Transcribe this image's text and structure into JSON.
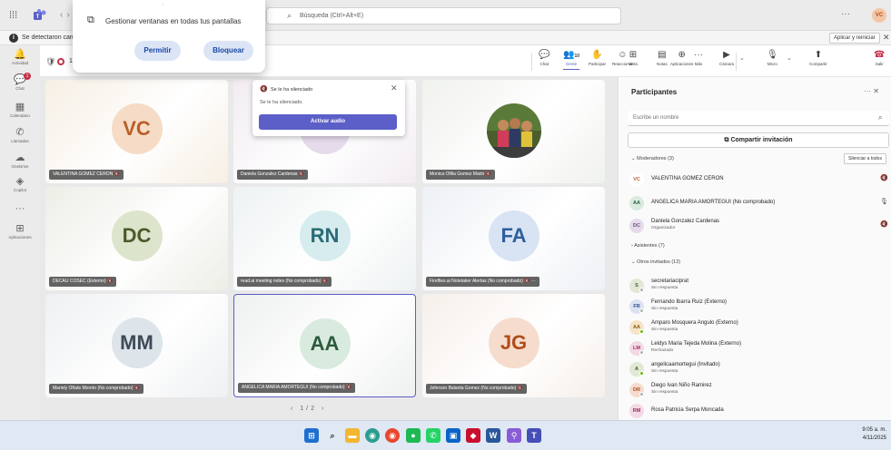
{
  "titlebar": {
    "search_placeholder": "Búsqueda (Ctrl+Alt+E)",
    "more": "···",
    "me_initials": "VC"
  },
  "notification": {
    "text": "Se detectaron cam",
    "apply_label": "Aplicar y reiniciar",
    "close": "✕"
  },
  "permission_popup": {
    "text": "Gestionar ventanas en todas tus pantallas",
    "allow": "Permitir",
    "block": "Bloquear"
  },
  "rail": [
    {
      "icon": "bell-icon",
      "glyph": "🔔",
      "label": "Actividad"
    },
    {
      "icon": "chat-icon",
      "glyph": "💬",
      "label": "Chat",
      "badge": "1"
    },
    {
      "icon": "calendar-icon",
      "glyph": "▦",
      "label": "Calendario"
    },
    {
      "icon": "phone-icon",
      "glyph": "✆",
      "label": "Llamadas"
    },
    {
      "icon": "cloud-icon",
      "glyph": "☁",
      "label": "OneDrive"
    },
    {
      "icon": "copilot-icon",
      "glyph": "◈",
      "label": "Copilot"
    },
    {
      "icon": "more-apps-icon",
      "glyph": "···",
      "label": ""
    },
    {
      "icon": "apps-icon",
      "glyph": "⊞",
      "label": "Aplicaciones"
    }
  ],
  "meeting": {
    "time": "11",
    "participants_count": "10",
    "toolbar": [
      {
        "id": "chat",
        "icon": "chat-icon",
        "glyph": "💬",
        "label": "Chat"
      },
      {
        "id": "people",
        "icon": "people-icon",
        "glyph": "👥",
        "label": "Gente",
        "active": true
      },
      {
        "id": "raise",
        "icon": "hand-icon",
        "glyph": "✋",
        "label": "Participar"
      },
      {
        "id": "react",
        "icon": "emoji-icon",
        "glyph": "☺",
        "label": "Reaccionar"
      },
      {
        "id": "view",
        "icon": "grid-view-icon",
        "glyph": "⊞",
        "label": "Vista"
      },
      {
        "id": "notes",
        "icon": "notes-icon",
        "glyph": "▤",
        "label": "Notas"
      },
      {
        "id": "apps",
        "icon": "apps-icon",
        "glyph": "⊕",
        "label": "Aplicaciones"
      },
      {
        "id": "more",
        "icon": "more-icon",
        "glyph": "···",
        "label": "Más"
      },
      {
        "id": "camera",
        "icon": "camera-icon",
        "glyph": "▶",
        "label": "Cámara"
      },
      {
        "id": "mic",
        "icon": "mic-icon",
        "glyph": "🎙",
        "label": "Micro"
      },
      {
        "id": "share",
        "icon": "share-icon",
        "glyph": "⬆",
        "label": "Compartir"
      }
    ],
    "leave_label": "Salir"
  },
  "tiles": [
    {
      "name": "VALENTINA GOMEZ CERON",
      "initials": "VC",
      "bg": "#f6efe4",
      "avbg": "#f6dcc6",
      "avfg": "#b95e2a"
    },
    {
      "name": "Daniela Gonzalez Cardenas",
      "initials": "DC",
      "bg": "#f2ecf2",
      "avbg": "#e6dbeb",
      "avfg": "#6b5179"
    },
    {
      "name": "Monica Ofilia Gomez Marin",
      "initials": "",
      "bg": "#f0f2ee",
      "photo": true
    },
    {
      "name": "DECAU COSEC (Externo)",
      "initials": "DC",
      "bg": "#eceee6",
      "avbg": "#dde4cc",
      "avfg": "#4a5a2c"
    },
    {
      "name": "read.ai meeting notes (No comprobado)",
      "initials": "RN",
      "bg": "#eef2f3",
      "avbg": "#d7ecee",
      "avfg": "#2b6b76"
    },
    {
      "name": "Fireflies.ai Notetaker Alertas (No comprobado)",
      "initials": "FA",
      "bg": "#edf0f5",
      "avbg": "#d8e4f3",
      "avfg": "#2e5e9d"
    },
    {
      "name": "Mariely Oñate Moreto (No comprobado)",
      "initials": "MM",
      "bg": "#eef0f2",
      "avbg": "#dde4ea",
      "avfg": "#3e4b57"
    },
    {
      "name": "ANGELICA MARIA AMORTEGUI (No comprobado)",
      "initials": "AA",
      "bg": "#eef1ef",
      "avbg": "#d9eadf",
      "avfg": "#2d5a3d",
      "selected": true
    },
    {
      "name": "Jeferson Balanta Gomez (No comprobado)",
      "initials": "JG",
      "bg": "#f6efea",
      "avbg": "#f6dccd",
      "avfg": "#b04d1c"
    }
  ],
  "pager": "‹ 1/2 ›",
  "silenced": {
    "title": "Se le ha silenciado",
    "text": "Se le ha silenciado.",
    "button": "Activar audio"
  },
  "panel": {
    "title": "Participantes",
    "search_placeholder": "Escribe un nombre",
    "share_label": "Compartir invitación",
    "moderators_label": "Moderadores (3)",
    "mute_all": "Silenciar a todos",
    "attendees_label": "Asistentes (7)",
    "others_label": "Otros invitados (12)",
    "moderators": [
      {
        "initials": "VC",
        "name": "VALENTINA GOMEZ CERON",
        "sub": "",
        "avbg": "#ffffff",
        "avfg": "#b95e2a",
        "mic": "🔇"
      },
      {
        "initials": "AA",
        "name": "ANGELICA MARIA AMORTEGUI (No comprobado)",
        "sub": "",
        "avbg": "#d9eadf",
        "avfg": "#2d5a3d",
        "mic": "🎙"
      },
      {
        "initials": "DC",
        "name": "Daniela Gonzalez Cardenas",
        "sub": "Organizador",
        "avbg": "#e6dbeb",
        "avfg": "#6b5179",
        "mic": "🔇"
      }
    ],
    "others": [
      {
        "initials": "S",
        "name": "secretariaciprat",
        "sub": "Sin respuesta",
        "avbg": "#e1e8d5",
        "avfg": "#4a5a2c",
        "dot": "#b0b0b0"
      },
      {
        "initials": "FR",
        "name": "Fernando Ibarra Ruiz (Externo)",
        "sub": "Sin respuesta",
        "avbg": "#dbe2f2",
        "avfg": "#2e4d8f",
        "dot": "#b0b0b0"
      },
      {
        "initials": "AA",
        "name": "Amparo Mosquera Angulo (Externo)",
        "sub": "Sin respuesta",
        "avbg": "#f5e4c7",
        "avfg": "#8a5a12",
        "dot": "#6bb700"
      },
      {
        "initials": "LM",
        "name": "Leidys Maria Tejeda Molina (Externo)",
        "sub": "Rechazado",
        "avbg": "#f3d8e6",
        "avfg": "#9b2e63",
        "dot": "#b0b0b0"
      },
      {
        "initials": "A",
        "name": "angelicaamortegui (Invitado)",
        "sub": "Sin respuesta",
        "avbg": "#e1e8d5",
        "avfg": "#4a5a2c",
        "dot": "#6bb700"
      },
      {
        "initials": "DR",
        "name": "Diego Ivan Niño Ramirez",
        "sub": "Sin respuesta",
        "avbg": "#f6dccd",
        "avfg": "#b04d1c",
        "dot": "#b0b0b0"
      },
      {
        "initials": "RM",
        "name": "Rosa Patricia Serpa Moncada",
        "sub": "",
        "avbg": "#f3d8e6",
        "avfg": "#9b2e63",
        "dot": ""
      }
    ]
  },
  "taskbar": {
    "icons": [
      "windows-icon",
      "search-icon",
      "file-explorer-icon",
      "chrome-icon",
      "chrome-icon",
      "spotify-icon",
      "whatsapp-icon",
      "outlook-icon",
      "mcafee-icon",
      "word-icon",
      "network-icon",
      "teams-icon"
    ],
    "time": "9:05 a. m.",
    "date": "4/11/2025"
  }
}
